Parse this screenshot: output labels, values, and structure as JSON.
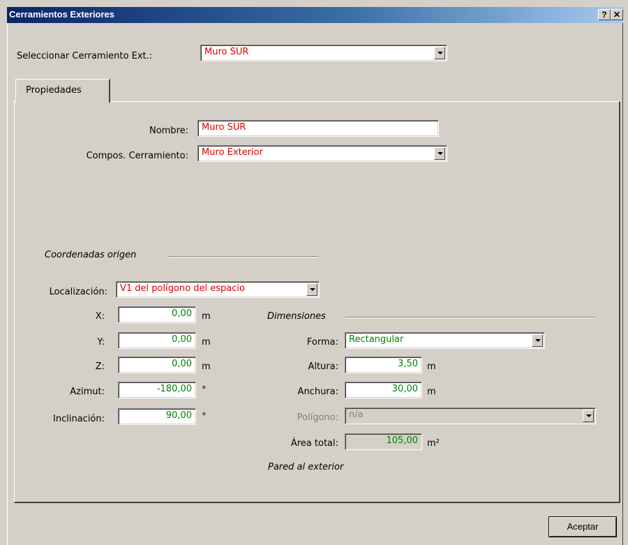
{
  "window": {
    "title": "Cerramientos Exteriores",
    "help_label": "?",
    "close_label": "✕"
  },
  "selector": {
    "label": "Seleccionar Cerramiento Ext.:",
    "value": "Muro SUR"
  },
  "tabs": [
    {
      "label": "Propiedades"
    }
  ],
  "properties": {
    "nombre_label": "Nombre:",
    "nombre_value": "Muro SUR",
    "composicion_label": "Compos. Cerramiento:",
    "composicion_value": "Muro Exterior"
  },
  "coordenadas": {
    "section_label": "Coordenadas origen",
    "localizacion_label": "Localización:",
    "localizacion_value": "V1 del polígono del espacio",
    "x_label": "X:",
    "x_value": "0,00",
    "x_unit": "m",
    "y_label": "Y:",
    "y_value": "0,00",
    "y_unit": "m",
    "z_label": "Z:",
    "z_value": "0,00",
    "z_unit": "m",
    "azimut_label": "Azimut:",
    "azimut_value": "-180,00",
    "azimut_unit": "°",
    "inclinacion_label": "Inclinación:",
    "inclinacion_value": "90,00",
    "inclinacion_unit": "°"
  },
  "dimensiones": {
    "section_label": "Dimensiones",
    "forma_label": "Forma:",
    "forma_value": "Rectangular",
    "altura_label": "Altura:",
    "altura_value": "3,50",
    "altura_unit": "m",
    "anchura_label": "Anchura:",
    "anchura_value": "30,00",
    "anchura_unit": "m",
    "poligono_label": "Polígono:",
    "poligono_value": "n/a",
    "area_label": "Área total:",
    "area_value": "105,00",
    "area_unit": "m²",
    "note": "Pared al exterior"
  },
  "footer": {
    "accept_label": "Aceptar"
  },
  "colors": {
    "title_start": "#0a246a",
    "title_end": "#a6caf0",
    "value_red": "#e00000",
    "value_green": "#008000",
    "face": "#d4d0c8"
  }
}
